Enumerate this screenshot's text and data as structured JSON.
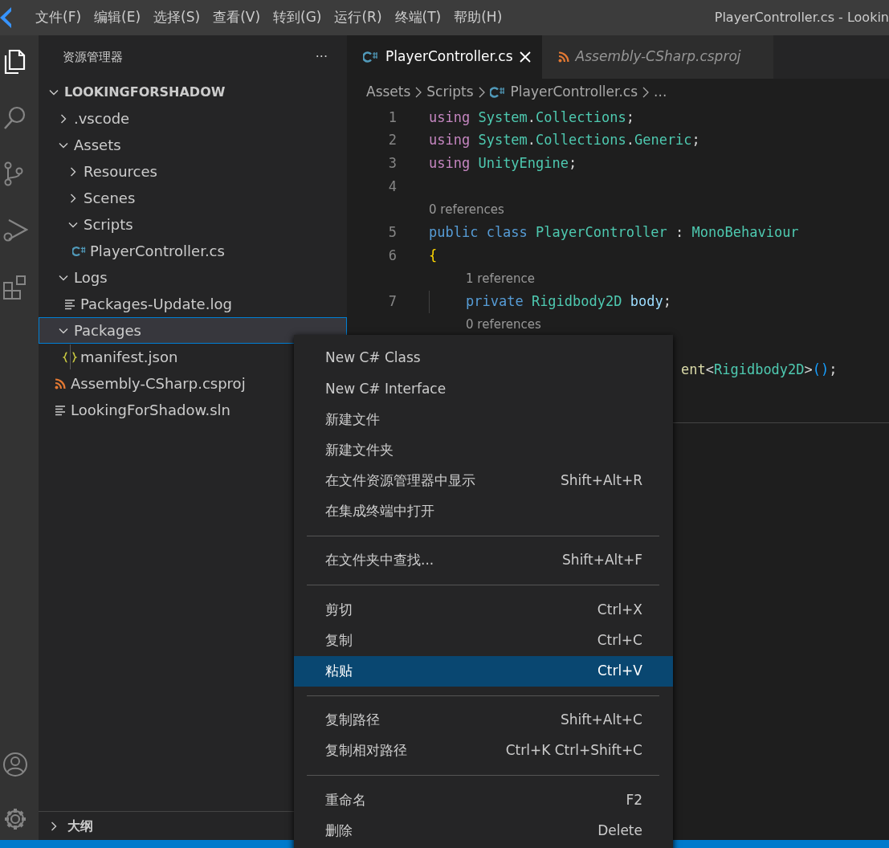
{
  "title_bar": {
    "menus": [
      "文件(F)",
      "编辑(E)",
      "选择(S)",
      "查看(V)",
      "转到(G)",
      "运行(R)",
      "终端(T)",
      "帮助(H)"
    ],
    "window_title": "PlayerController.cs - Lookin"
  },
  "activity_bar": [
    {
      "kind": "files",
      "selected": true
    },
    {
      "kind": "search",
      "selected": false
    },
    {
      "kind": "source",
      "selected": false
    },
    {
      "kind": "debug",
      "selected": false
    },
    {
      "kind": "extensions",
      "selected": false
    }
  ],
  "activity_bottom": [
    {
      "kind": "account"
    },
    {
      "kind": "settings"
    }
  ],
  "sidebar": {
    "title": "资源管理器",
    "more": "···",
    "root": {
      "label": "LOOKINGFORSHADOW",
      "expanded": true
    },
    "tree": [
      {
        "label": ".vscode",
        "kind": "folder",
        "expanded": false,
        "selected": false
      },
      {
        "label": "Assets",
        "kind": "folder",
        "expanded": true,
        "selected": false,
        "children": [
          {
            "label": "Resources",
            "kind": "folder",
            "expanded": false,
            "selected": false
          },
          {
            "label": "Scenes",
            "kind": "folder",
            "expanded": false,
            "selected": false
          },
          {
            "label": "Scripts",
            "kind": "folder",
            "expanded": true,
            "selected": false,
            "children": [
              {
                "label": "PlayerController.cs",
                "kind": "cs",
                "selected": false
              }
            ]
          }
        ]
      },
      {
        "label": "Logs",
        "kind": "folder",
        "expanded": true,
        "selected": false,
        "children": [
          {
            "label": "Packages-Update.log",
            "kind": "text",
            "selected": false
          }
        ]
      },
      {
        "label": "Packages",
        "kind": "folder",
        "expanded": true,
        "selected": true,
        "children": [
          {
            "label": "manifest.json",
            "kind": "json",
            "selected": false
          }
        ]
      },
      {
        "label": "Assembly-CSharp.csproj",
        "kind": "rss",
        "selected": false
      },
      {
        "label": "LookingForShadow.sln",
        "kind": "text",
        "selected": false
      }
    ],
    "outline": {
      "label": "大纲",
      "expanded": false
    }
  },
  "tabs": [
    {
      "label": "PlayerController.cs",
      "kind": "cs",
      "selected": true,
      "preview": false
    },
    {
      "label": "Assembly-CSharp.csproj",
      "kind": "rss",
      "selected": false,
      "preview": true
    }
  ],
  "breadcrumbs": [
    {
      "label": "Assets"
    },
    {
      "label": "Scripts"
    },
    {
      "label": "PlayerController.cs",
      "kind": "cs"
    },
    {
      "label": "..."
    }
  ],
  "code": [
    {
      "kind": "line",
      "number": "1",
      "tokens": [
        {
          "text": "using ",
          "color": "#c586c0"
        },
        {
          "text": "System",
          "color": "#4ec9b0"
        },
        {
          "text": "."
        },
        {
          "text": "Collections",
          "color": "#4ec9b0"
        },
        {
          "text": ";"
        }
      ]
    },
    {
      "kind": "line",
      "number": "2",
      "tokens": [
        {
          "text": "using ",
          "color": "#c586c0"
        },
        {
          "text": "System",
          "color": "#4ec9b0"
        },
        {
          "text": "."
        },
        {
          "text": "Collections",
          "color": "#4ec9b0"
        },
        {
          "text": "."
        },
        {
          "text": "Generic",
          "color": "#4ec9b0"
        },
        {
          "text": ";"
        }
      ]
    },
    {
      "kind": "line",
      "number": "3",
      "tokens": [
        {
          "text": "using ",
          "color": "#c586c0"
        },
        {
          "text": "UnityEngine",
          "color": "#4ec9b0"
        },
        {
          "text": ";",
          "color": "#d4d4d4"
        }
      ]
    },
    {
      "kind": "line",
      "number": "4"
    },
    {
      "kind": "lens",
      "text": "0 references"
    },
    {
      "kind": "line",
      "number": "5",
      "tokens": [
        {
          "text": "public class ",
          "color": "#569cd6"
        },
        {
          "text": "PlayerController ",
          "color": "#4ec9b0"
        },
        {
          "text": ": ",
          "color": "#d4d4d4"
        },
        {
          "text": "MonoBehaviour",
          "color": "#4ec9b0"
        }
      ]
    },
    {
      "kind": "line",
      "number": "6",
      "tokens": [
        {
          "text": "{",
          "color": "#ffd700"
        }
      ],
      "children": [
        {
          "kind": "lens",
          "text": "1 reference"
        },
        {
          "kind": "line",
          "number": "7",
          "tokens": [
            {
              "text": "private ",
              "color": "#569cd6"
            },
            {
              "text": "Rigidbody2D ",
              "color": "#4ec9b0"
            },
            {
              "text": "body",
              "color": "#9cdcfe"
            },
            {
              "text": ";",
              "color": "#d4d4d4"
            }
          ]
        },
        {
          "kind": "lens",
          "text": "0 references"
        }
      ]
    },
    {
      "kind": "fragment",
      "tokens": [
        {
          "text": "ent",
          "color": "#dcdcaa"
        },
        {
          "text": "<",
          "color": "#d4d4d4"
        },
        {
          "text": "Rigidbody2D",
          "color": "#4ec9b0"
        },
        {
          "text": ">",
          "color": "#d4d4d4"
        },
        {
          "text": "()",
          "color": "#179fff"
        },
        {
          "text": ";",
          "color": "#d4d4d4"
        }
      ]
    }
  ],
  "context_menu": [
    [
      {
        "label": "New C# Class",
        "selected": false
      },
      {
        "label": "New C# Interface",
        "selected": false
      },
      {
        "label": "新建文件",
        "selected": false
      },
      {
        "label": "新建文件夹",
        "selected": false
      },
      {
        "label": "在文件资源管理器中显示",
        "shortcut": "Shift+Alt+R",
        "selected": false
      },
      {
        "label": "在集成终端中打开",
        "selected": false
      }
    ],
    [
      {
        "label": "在文件夹中查找...",
        "shortcut": "Shift+Alt+F",
        "selected": false
      }
    ],
    [
      {
        "label": "剪切",
        "shortcut": "Ctrl+X",
        "selected": false
      },
      {
        "label": "复制",
        "shortcut": "Ctrl+C",
        "selected": false
      },
      {
        "label": "粘贴",
        "shortcut": "Ctrl+V",
        "selected": true
      }
    ],
    [
      {
        "label": "复制路径",
        "shortcut": "Shift+Alt+C",
        "selected": false
      },
      {
        "label": "复制相对路径",
        "shortcut": "Ctrl+K Ctrl+Shift+C",
        "selected": false
      }
    ],
    [
      {
        "label": "重命名",
        "shortcut": "F2",
        "selected": false
      },
      {
        "label": "删除",
        "shortcut": "Delete",
        "selected": false
      }
    ]
  ]
}
